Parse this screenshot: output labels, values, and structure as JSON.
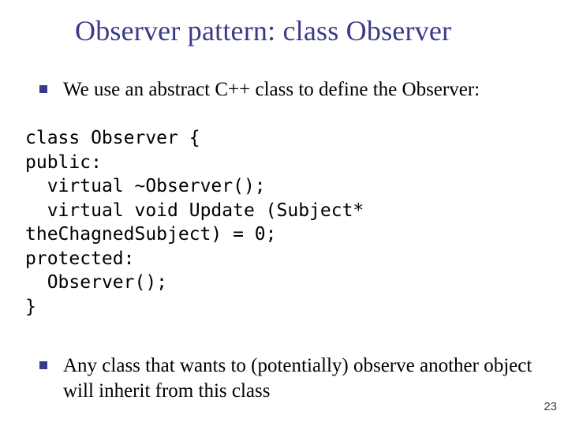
{
  "title": "Observer pattern: class Observer",
  "bullets": {
    "b1": "We use an abstract C++ class to define the Observer:",
    "b2": "Any class that wants to (potentially) observe another object will inherit from this class"
  },
  "code": "class Observer {\npublic:\n  virtual ~Observer();\n  virtual void Update (Subject* theChagnedSubject) = 0;\nprotected:\n  Observer();\n}",
  "page_number": "23",
  "colors": {
    "accent": "#3a3a8a",
    "text": "#000000",
    "page_num": "#404040"
  }
}
